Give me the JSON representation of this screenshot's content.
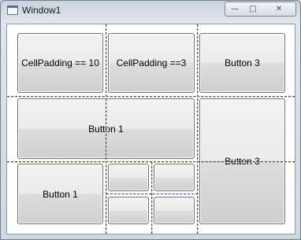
{
  "window": {
    "title": "Window1",
    "controls": {
      "minimize": "—",
      "maximize": "□",
      "close": "✕"
    }
  },
  "buttons": {
    "r0c0": "CellPadding == 10",
    "r0c1": "CellPadding ==3",
    "r0c2": "Button 3",
    "r1_span": "Button 1",
    "right_span": "Button 3",
    "r2c0": "Button 1"
  },
  "icons": {
    "app": "window-app-icon"
  }
}
